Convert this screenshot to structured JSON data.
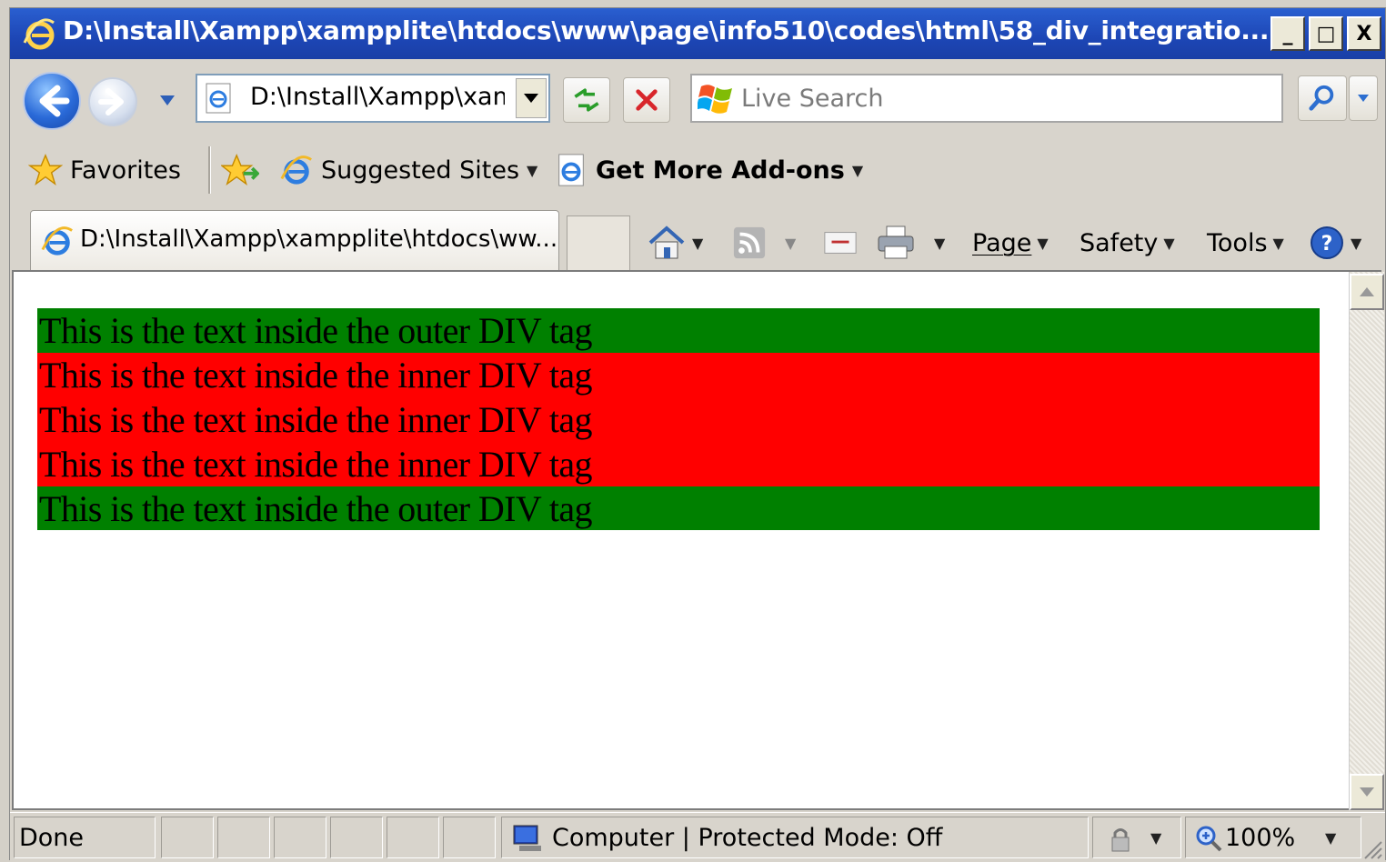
{
  "window": {
    "title": "D:\\Install\\Xampp\\xampplite\\htdocs\\www\\page\\info510\\codes\\html\\58_div_integratio...",
    "minimize_label": "_",
    "maximize_label": "□",
    "close_label": "X"
  },
  "nav": {
    "address": "D:\\Install\\Xampp\\xamp",
    "search_placeholder": "Live Search"
  },
  "favorites_bar": {
    "favorites_label": "Favorites",
    "suggested_sites_label": "Suggested Sites",
    "get_addons_label": "Get More Add-ons"
  },
  "tabs": [
    {
      "label": "D:\\Install\\Xampp\\xampplite\\htdocs\\ww..."
    }
  ],
  "command_bar": {
    "page_label": "Page",
    "safety_label": "Safety",
    "tools_label": "Tools"
  },
  "page": {
    "outer_color": "#008000",
    "inner_color": "#ff0000",
    "outer_top_text": "This is the text inside the outer DIV tag",
    "inner_lines": [
      "This is the text inside the inner DIV tag",
      "This is the text inside the inner DIV tag",
      "This is the text inside the inner DIV tag"
    ],
    "outer_bottom_text": "This is the text inside the outer DIV tag"
  },
  "status": {
    "text": "Done",
    "zone": "Computer | Protected Mode: Off",
    "zoom": "100%"
  }
}
